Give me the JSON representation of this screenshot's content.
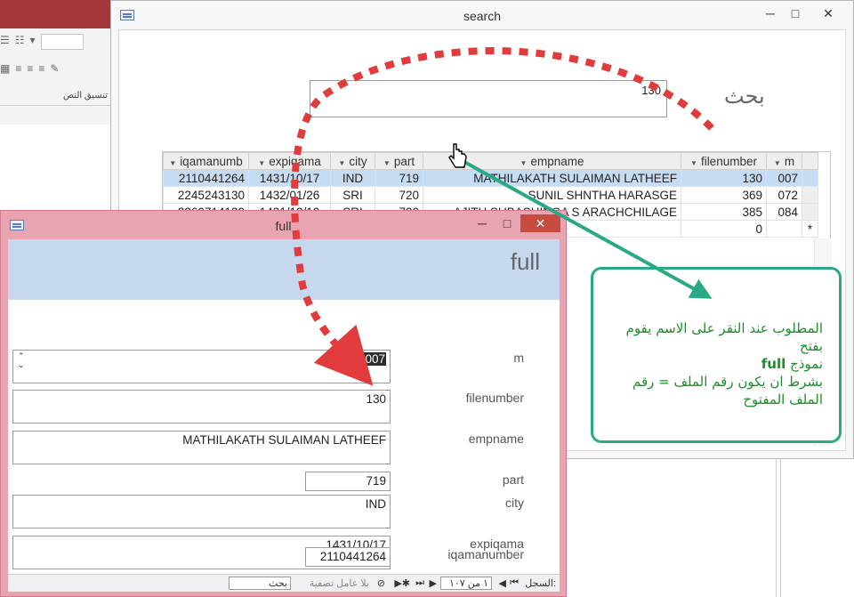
{
  "ribbon": {
    "group_label": "تنسيق النص"
  },
  "search_window": {
    "title": "search",
    "label": "بحث",
    "search_value": "130",
    "columns": [
      "iqamanumb",
      "expiqama",
      "city",
      "part",
      "empname",
      "filenumber",
      "m"
    ],
    "rows": [
      {
        "iqamanumber": "2110441264",
        "expiqama": "1431/10/17",
        "city": "IND",
        "part": "719",
        "empname": "MATHILAKATH SULAIMAN LATHEEF",
        "filenumber": "130",
        "m": "007"
      },
      {
        "iqamanumber": "2245243130",
        "expiqama": "1432/01/26",
        "city": "SRI",
        "part": "720",
        "empname": "SUNIL SHNTHA HARASGE",
        "filenumber": "369",
        "m": "072"
      },
      {
        "iqamanumber": "2260714130",
        "expiqama": "1431/12/10",
        "city": "SRI",
        "part": "720",
        "empname": "AJITH SUBASHINGA S ARACHCHILAGE",
        "filenumber": "385",
        "m": "084"
      }
    ],
    "new_row": {
      "filenumber": "0",
      "selector": "*"
    }
  },
  "full_window": {
    "title": "full",
    "form_title": "full",
    "fields": {
      "m": {
        "label": "m",
        "value": "007"
      },
      "filenumber": {
        "label": "filenumber",
        "value": "130"
      },
      "empname": {
        "label": "empname",
        "value": "MATHILAKATH SULAIMAN LATHEEF"
      },
      "part": {
        "label": "part",
        "value": "719"
      },
      "city": {
        "label": "city",
        "value": "IND"
      },
      "expiqama": {
        "label": "expiqama",
        "value": "1431/10/17"
      },
      "iqamanumber": {
        "label": "iqamanumber",
        "value": "2110441264"
      }
    },
    "navigation": {
      "record_label": "السجل:",
      "record_position": "١ من ١٠٧",
      "filter_status": "بلا عامل تصفية",
      "search_label": "بحث"
    }
  },
  "callout": {
    "line1": "المطلوب عند النقر على الاسم يقوم بفتح",
    "form_name": "full",
    "line2_suffix": "نموذج",
    "line3": "بشرط ان يكون رقم الملف = رقم الملف المفتوح"
  },
  "colors": {
    "callout_border": "#2aa985",
    "callout_text": "#1b8f2a",
    "arrow_red": "#e23b3b",
    "selected_row": "#c5dcf3"
  }
}
